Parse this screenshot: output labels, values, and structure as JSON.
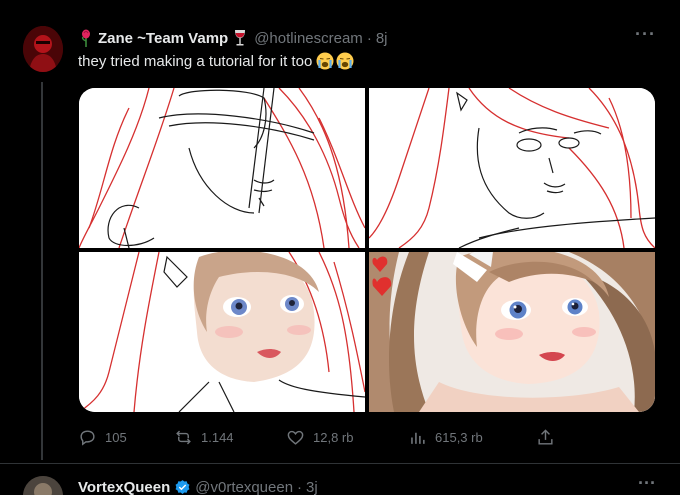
{
  "tweet": {
    "author": {
      "display_name": "Zane ~Team Vamp",
      "handle": "@hotlinescream",
      "time": "8j",
      "name_prefix_icon": "rose-icon",
      "name_suffix_icon": "wine-glass-icon"
    },
    "text": "they tried making a tutorial for it too",
    "text_emojis": [
      "loudly-crying-face-icon",
      "loudly-crying-face-icon"
    ],
    "more_label": "···",
    "media": {
      "panel_count": 4,
      "panels": [
        "sketch-lines",
        "sketch-face",
        "partially-colored",
        "finished-render"
      ]
    },
    "actions": {
      "replies": "105",
      "retweets": "1.144",
      "likes": "12,8 rb",
      "views": "615,3 rb"
    }
  },
  "next_tweet": {
    "author": {
      "display_name": "VortexQueen",
      "handle": "@v0rtexqueen",
      "time": "3j",
      "verified": true
    },
    "more_label": "···"
  },
  "colors": {
    "background": "#000000",
    "text_primary": "#e7e9ea",
    "text_secondary": "#71767b",
    "verified_blue": "#1d9bf0",
    "divider": "#2f3336"
  }
}
